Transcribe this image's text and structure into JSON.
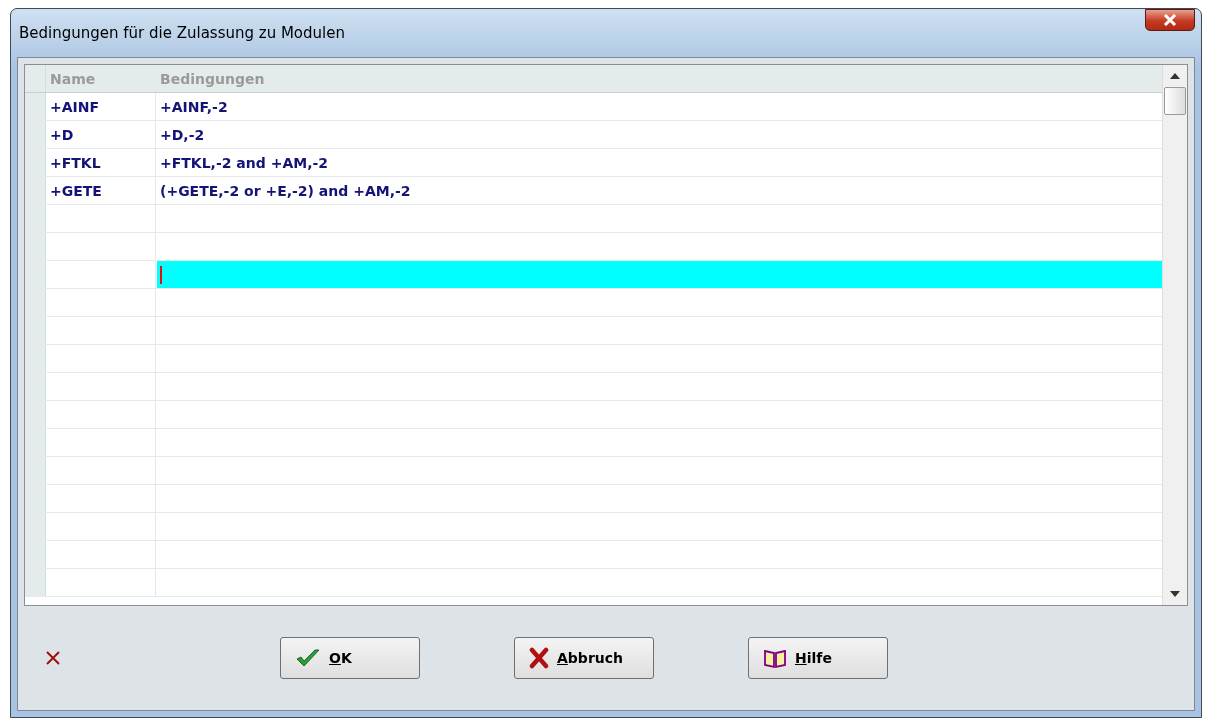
{
  "window": {
    "title": "Bedingungen für die Zulassung zu Modulen"
  },
  "grid": {
    "columns": [
      "Name",
      "Bedingungen"
    ],
    "rows": [
      {
        "name": "+AINF",
        "condition": "+AINF,-2"
      },
      {
        "name": "+D",
        "condition": "+D,-2"
      },
      {
        "name": "+FTKL",
        "condition": "+FTKL,-2 and +AM,-2"
      },
      {
        "name": "+GETE",
        "condition": "(+GETE,-2 or +E,-2) and +AM,-2"
      }
    ],
    "edit_row": {
      "selected": true
    }
  },
  "buttons": [
    {
      "kind": "ok",
      "label": "OK"
    },
    {
      "kind": "cancel",
      "label": "Abbruch"
    },
    {
      "kind": "help",
      "label": "Hilfe"
    }
  ]
}
